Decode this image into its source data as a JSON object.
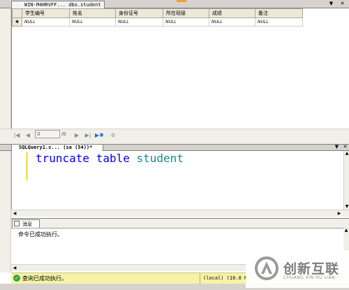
{
  "document_tab": {
    "title": "WIN-M4HRVFF... dbo.student"
  },
  "results_grid": {
    "columns": [
      "学生编号",
      "姓名",
      "身份证号",
      "所在班级",
      "成绩",
      "备注"
    ],
    "row_marker": "✱",
    "new_row": [
      "NULL",
      "NULL",
      "NULL",
      "NULL",
      "NULL",
      "NULL"
    ]
  },
  "record_nav": {
    "current": "0",
    "total": "/0"
  },
  "editor": {
    "tab_title": "SQLQuery1.s... (sa (54))*",
    "code": {
      "keyword1": "truncate",
      "keyword2": "table",
      "identifier": "student"
    }
  },
  "messages": {
    "tab_label": "消息",
    "text": "命令已成功执行。"
  },
  "statusbar": {
    "text": "查询已成功执行。",
    "server": "(local) (10.0 RT"
  },
  "logo": {
    "cn_text": "创新互联",
    "en_text": "CHUANG XIN HU LIAN"
  },
  "colors": {
    "keyword": "#0000ff",
    "identifier": "#1a8a8a",
    "status_bg": "#f6f3a6",
    "success": "#3aa43a"
  }
}
